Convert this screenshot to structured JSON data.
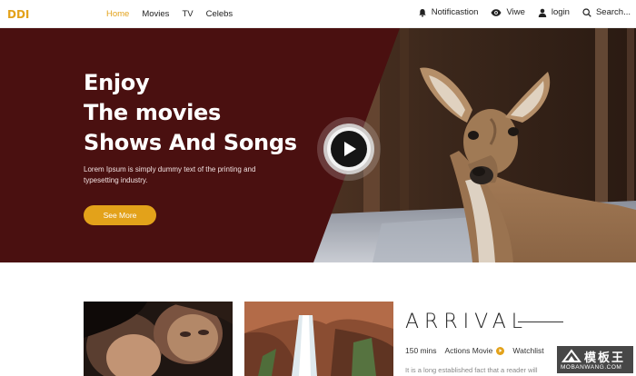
{
  "nav": {
    "logo": "DDI",
    "menu": [
      {
        "label": "Home",
        "active": true
      },
      {
        "label": "Movies",
        "active": false
      },
      {
        "label": "TV",
        "active": false
      },
      {
        "label": "Celebs",
        "active": false
      }
    ],
    "notification": "Notificastion",
    "view": "Viwe",
    "login": "login",
    "search": "Search..."
  },
  "hero": {
    "title_line1": "Enjoy",
    "title_line2": "The movies",
    "title_line3": "Shows And Songs",
    "description": "Lorem Ipsum is simply dummy text of the printing and typesetting industry.",
    "cta": "See More"
  },
  "featured": {
    "title": "ARRIVAL",
    "duration": "150 mins",
    "genre": "Actions Movie",
    "watchlist": "Watchlist",
    "description": "It is a long established fact that a reader will"
  },
  "watermark": {
    "text": "模板王",
    "url": "MOBANWANG.COM"
  },
  "colors": {
    "accent": "#e3a21a",
    "hero_dark": "#4a1010"
  }
}
